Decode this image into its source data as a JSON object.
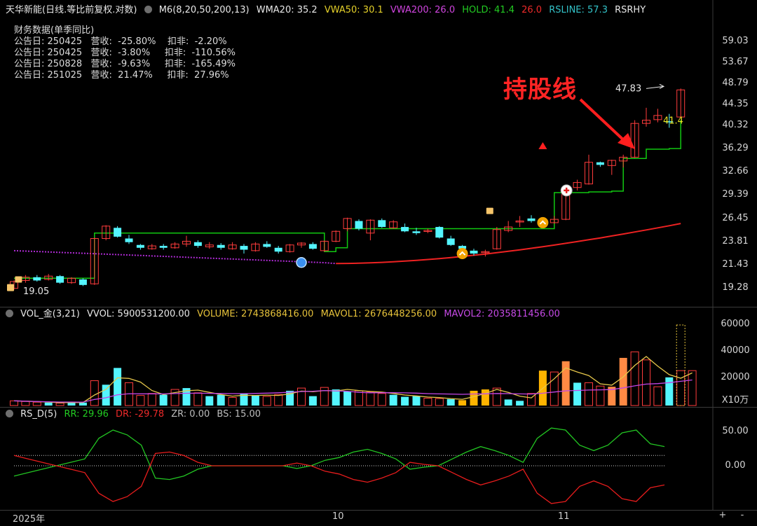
{
  "header_main": {
    "title": "天华新能(日线.等比前复权.对数)",
    "indicator": "M6(8,20,50,200,13)",
    "wma20": "WMA20: 35.2",
    "vwa50": "VWA50: 30.1",
    "vwa200": "VWA200: 26.0",
    "hold": "HOLD: 41.4",
    "hold2": "26.0",
    "rsline": "RSLINE: 57.3",
    "rsrhy": "RSRHY"
  },
  "financial": {
    "title": "财务数据(单季同比)",
    "rows": [
      "公告日: 250425   营收:  -25.80%    扣非:  -2.20%",
      "公告日: 250425   营收:  -3.80%     扣非:  -110.56%",
      "公告日: 250828   营收:  -9.63%     扣非:  -165.49%",
      "公告日: 251025   营收:  21.47%     扣非:  27.96%"
    ]
  },
  "annotation": "持股线",
  "price_labels": {
    "high": "47.83",
    "low": "19.05",
    "hold": "41.4"
  },
  "price_axis": [
    "59.03",
    "53.67",
    "48.79",
    "44.35",
    "40.32",
    "36.29",
    "32.66",
    "29.39",
    "26.45",
    "23.81",
    "21.43",
    "19.28"
  ],
  "header_vol": {
    "name": "VOL_金(3,21)",
    "vvol": "VVOL: 5900531200.00",
    "volume": "VOLUME: 2743868416.00",
    "mavol1": "MAVOL1: 2676448256.00",
    "mavol2": "MAVOL2: 2035811456.00"
  },
  "vol_axis": [
    "60000",
    "40000",
    "20000"
  ],
  "vol_unit": "X10万",
  "header_rs": {
    "name": "RS_D(5)",
    "rr": "RR: 29.96",
    "dr": "DR: -29.78",
    "zr": "ZR: 0.00",
    "bs": "BS: 15.00"
  },
  "rs_axis": [
    "50.00",
    "0.00"
  ],
  "x_axis": [
    "2025年",
    "10",
    "11"
  ],
  "zoom": {
    "plus": "+",
    "minus": "-"
  },
  "colors": {
    "up": "#ff3c3c",
    "down": "#54f5ff",
    "hold": "#11c811",
    "vwa200": "#ee2222",
    "vwa_dots": "#b02bd6",
    "mavol1": "#e5c64a",
    "mavol2": "#c246e6",
    "vol_gold": "#ffb400",
    "vol_orange": "#ff8a44"
  },
  "chart_data": {
    "type": "candlestick",
    "candles": [
      [
        19.3,
        19.9,
        19.2,
        20.0
      ],
      [
        20.0,
        20.3,
        19.8,
        20.5
      ],
      [
        20.3,
        20.0,
        19.9,
        20.5
      ],
      [
        20.1,
        20.4,
        20.0,
        20.6
      ],
      [
        20.4,
        19.8,
        19.7,
        20.5
      ],
      [
        19.8,
        20.2,
        19.7,
        20.3
      ],
      [
        20.1,
        19.6,
        19.5,
        20.2
      ],
      [
        19.7,
        24.2,
        19.6,
        24.3
      ],
      [
        24.2,
        25.6,
        24.0,
        25.7
      ],
      [
        25.4,
        24.4,
        24.3,
        25.6
      ],
      [
        24.2,
        23.8,
        23.6,
        24.6
      ],
      [
        23.5,
        23.2,
        23.0,
        23.6
      ],
      [
        23.1,
        23.4,
        23.0,
        23.6
      ],
      [
        23.4,
        23.2,
        23.0,
        23.6
      ],
      [
        23.2,
        23.6,
        23.1,
        23.8
      ],
      [
        23.6,
        23.9,
        23.3,
        24.5
      ],
      [
        23.8,
        23.4,
        23.2,
        24.0
      ],
      [
        23.3,
        23.5,
        23.1,
        23.8
      ],
      [
        23.5,
        23.2,
        23.0,
        23.7
      ],
      [
        23.1,
        23.5,
        23.0,
        23.8
      ],
      [
        23.4,
        23.0,
        22.6,
        23.6
      ],
      [
        22.9,
        23.6,
        22.8,
        23.8
      ],
      [
        23.6,
        23.3,
        23.2,
        23.9
      ],
      [
        23.2,
        22.8,
        22.6,
        23.4
      ],
      [
        22.8,
        23.5,
        22.7,
        23.6
      ],
      [
        23.5,
        23.7,
        23.2,
        23.8
      ],
      [
        23.6,
        23.1,
        23.0,
        23.8
      ],
      [
        22.9,
        23.9,
        22.8,
        24.0
      ],
      [
        23.9,
        25.0,
        23.8,
        25.1
      ],
      [
        25.3,
        26.5,
        25.0,
        26.6
      ],
      [
        26.2,
        25.3,
        25.1,
        26.4
      ],
      [
        24.8,
        26.3,
        24.0,
        26.4
      ],
      [
        26.3,
        25.5,
        25.4,
        26.5
      ],
      [
        25.4,
        26.1,
        25.3,
        26.3
      ],
      [
        25.5,
        25.0,
        24.9,
        25.9
      ],
      [
        25.0,
        24.8,
        24.6,
        25.4
      ],
      [
        25.0,
        25.1,
        24.8,
        25.3
      ],
      [
        25.5,
        24.3,
        24.2,
        25.6
      ],
      [
        24.2,
        23.5,
        23.4,
        24.5
      ],
      [
        23.4,
        23.1,
        22.9,
        23.5
      ],
      [
        22.9,
        22.6,
        22.4,
        23.1
      ],
      [
        22.8,
        22.8,
        22.3,
        23.0
      ],
      [
        23.1,
        25.2,
        23.0,
        25.5
      ],
      [
        25.1,
        25.5,
        24.9,
        26.2
      ],
      [
        26.2,
        26.2,
        25.5,
        26.8
      ],
      [
        26.5,
        26.2,
        26.0,
        26.9
      ],
      [
        26.3,
        26.1,
        26.0,
        26.4
      ],
      [
        26.0,
        26.4,
        25.9,
        26.8
      ],
      [
        26.4,
        30.4,
        26.3,
        30.8
      ],
      [
        30.5,
        31.2,
        30.1,
        31.6
      ],
      [
        31.0,
        34.2,
        30.9,
        35.4
      ],
      [
        34.2,
        33.8,
        33.5,
        34.3
      ],
      [
        33.7,
        34.5,
        32.3,
        34.6
      ],
      [
        34.4,
        35.0,
        33.4,
        35.4
      ],
      [
        35.0,
        40.8,
        34.9,
        41.4
      ],
      [
        40.8,
        41.4,
        40.2,
        43.8
      ],
      [
        41.5,
        42.3,
        41.0,
        43.6
      ],
      [
        41.2,
        41.0,
        40.0,
        42.6
      ],
      [
        42.0,
        47.5,
        41.9,
        47.8
      ]
    ],
    "volume": [
      3500,
      3000,
      2500,
      2200,
      1800,
      2800,
      2200,
      18500,
      15500,
      28000,
      17000,
      7500,
      9000,
      8000,
      12000,
      13000,
      9500,
      7000,
      8000,
      6000,
      9000,
      7500,
      6800,
      8200,
      11000,
      13000,
      7000,
      13500,
      12000,
      10500,
      11000,
      10000,
      9000,
      8000,
      6500,
      7000,
      5500,
      5200,
      4800,
      4000,
      11000,
      12000,
      13000,
      4500,
      3500,
      9000,
      26000,
      25000,
      33000,
      17000,
      17000,
      14500,
      14000,
      35500,
      40000,
      34000,
      14000,
      21000,
      26000,
      26000
    ],
    "vol_bar_colors": [
      "u",
      "u",
      "u",
      "d",
      "u",
      "d",
      "d",
      "u",
      "d",
      "d",
      "u",
      "u",
      "u",
      "d",
      "u",
      "d",
      "u",
      "d",
      "d",
      "u",
      "d",
      "d",
      "u",
      "u",
      "d",
      "u",
      "d",
      "u",
      "d",
      "d",
      "u",
      "u",
      "u",
      "d",
      "d",
      "d",
      "u",
      "u",
      "d",
      "g",
      "g",
      "g",
      "u",
      "d",
      "d",
      "u",
      "g",
      "u",
      "o",
      "d",
      "u",
      "u",
      "o",
      "o",
      "u",
      "u",
      "u",
      "d",
      "u"
    ]
  }
}
